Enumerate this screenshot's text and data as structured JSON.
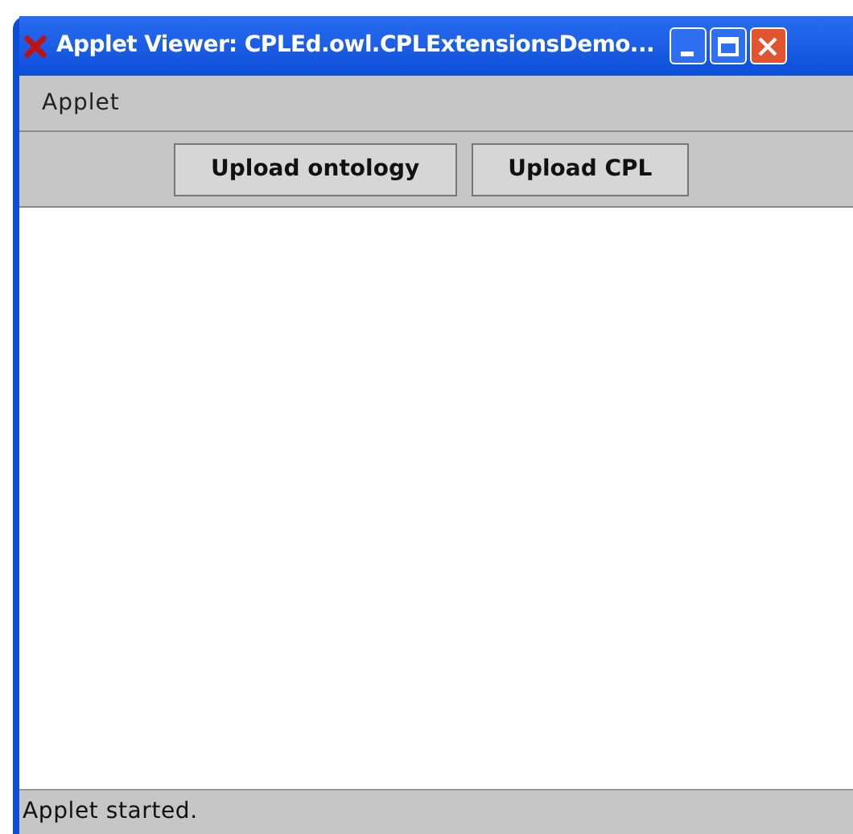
{
  "window": {
    "title": "Applet Viewer: CPLEd.owl.CPLExtensionsDemo..."
  },
  "menu": [
    "Applet"
  ],
  "buttons": [
    "Upload ontology",
    "Upload CPL"
  ],
  "status_bar": "Applet started."
}
